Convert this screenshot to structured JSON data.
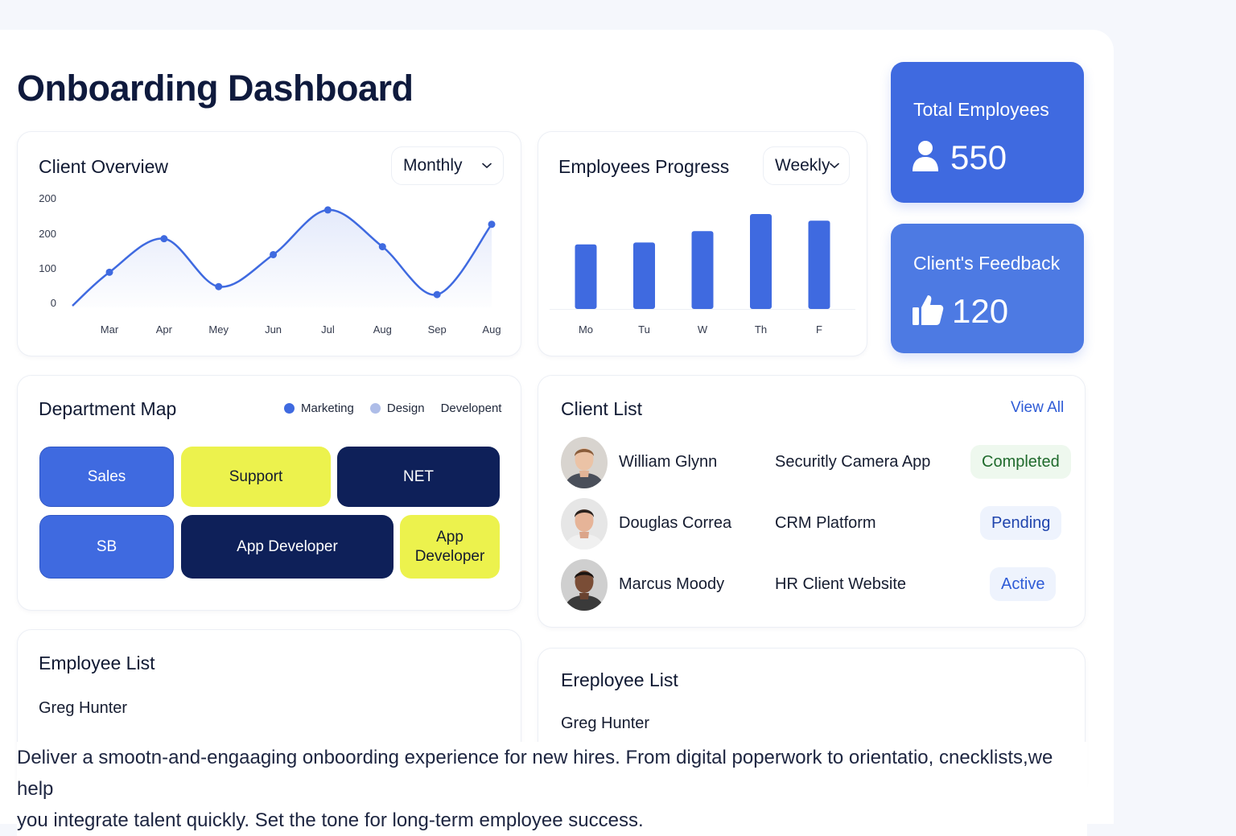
{
  "page": {
    "title": "Onboarding Dashboard"
  },
  "client_overview": {
    "title": "Client Overview",
    "period": "Monthly",
    "chart_data": {
      "type": "line",
      "x": [
        "Mar",
        "Apr",
        "Mey",
        "Jun",
        "Jul",
        "Aug",
        "Sep",
        "Aug"
      ],
      "y_tick_labels": [
        "0",
        "100",
        "200",
        "200"
      ],
      "values": [
        85,
        190,
        40,
        140,
        280,
        165,
        15,
        235
      ],
      "ylim": [
        -25,
        310
      ]
    }
  },
  "employees_progress": {
    "title": "Employees Progress",
    "period": "Weekly",
    "chart_data": {
      "type": "bar",
      "categories": [
        "Mo",
        "Tu",
        "W",
        "Th",
        "F"
      ],
      "values": [
        68,
        70,
        82,
        100,
        93
      ],
      "ylim": [
        0,
        100
      ]
    }
  },
  "stats": {
    "total_employees": {
      "label": "Total Employees",
      "value": "550",
      "icon": "user-icon"
    },
    "client_feedback": {
      "label": "Client's Feedback",
      "value": "120",
      "icon": "thumbs-up-icon"
    }
  },
  "department_map": {
    "title": "Department Map",
    "legend": [
      {
        "label": "Marketing",
        "color": "#3f6ae0"
      },
      {
        "label": "Design",
        "color": "#aebde8"
      },
      {
        "label": "Developent",
        "color": ""
      }
    ],
    "tiles": [
      "Sales",
      "Support",
      "NET",
      "SB",
      "App Developer",
      "App Developer"
    ]
  },
  "client_list": {
    "title": "Client List",
    "view_all": "View All",
    "rows": [
      {
        "name": "William Glynn",
        "project": "Securitly Camera App",
        "status": "Completed"
      },
      {
        "name": "Douglas Correa",
        "project": "CRM Platform",
        "status": "Pending"
      },
      {
        "name": "Marcus Moody",
        "project": "HR Client Website",
        "status": "Active"
      }
    ]
  },
  "employee_list_left": {
    "title": "Employee List",
    "items": [
      "Greg Hunter"
    ]
  },
  "employee_list_right": {
    "title": "Ereployee List",
    "items": [
      "Greg Hunter"
    ]
  },
  "caption": {
    "line1": "Deliver a smootn-and-engaaging onboording experience for new hires. From digital poperwork to orientatio, cnecklists,we help",
    "line2": "you integrate talent quickly. Set the tone for long-term employee success."
  },
  "colors": {
    "primary": "#3f6ae0",
    "primary_light": "#4d7ae3",
    "yellow": "#ecf24d",
    "navy": "#0e2059",
    "completed_bg": "#eef8ee",
    "completed_text": "#1f6a2c",
    "pending_bg": "#eef3fd",
    "pending_text": "#1f44ad",
    "active_bg": "#eef3fd",
    "active_text": "#2e5bd6"
  }
}
